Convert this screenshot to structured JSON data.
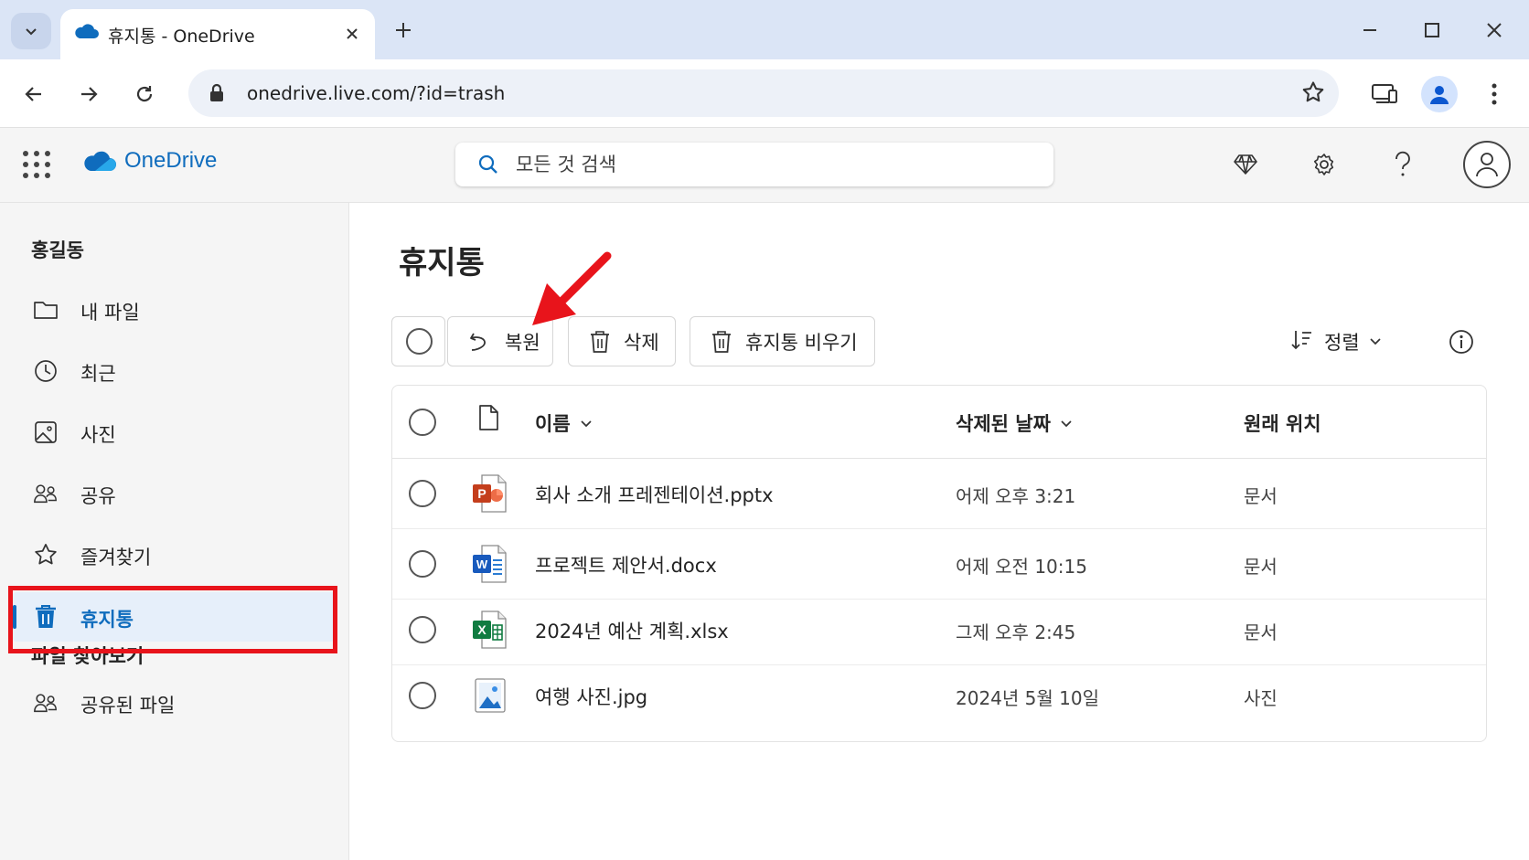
{
  "browser": {
    "tab_title": "휴지통 - OneDrive",
    "url": "onedrive.live.com/?id=trash"
  },
  "header": {
    "brand": "OneDrive",
    "search_placeholder": "모든 것 검색"
  },
  "sidebar": {
    "user_name": "홍길동",
    "items": [
      {
        "label": "내 파일",
        "icon": "folder-icon"
      },
      {
        "label": "최근",
        "icon": "clock-icon"
      },
      {
        "label": "사진",
        "icon": "image-icon"
      },
      {
        "label": "공유",
        "icon": "people-icon"
      },
      {
        "label": "즐겨찾기",
        "icon": "star-icon"
      },
      {
        "label": "휴지통",
        "icon": "trash-icon",
        "active": true
      }
    ],
    "browse_section": "파일 찾아보기",
    "browse_items": [
      {
        "label": "공유된 파일",
        "icon": "people-icon"
      }
    ]
  },
  "main": {
    "title": "휴지통",
    "commands": {
      "restore": "복원",
      "delete": "삭제",
      "empty": "휴지통 비우기",
      "sort": "정렬"
    },
    "columns": {
      "name": "이름",
      "deleted": "삭제된 날짜",
      "location": "원래 위치"
    },
    "files": [
      {
        "name": "회사 소개 프레젠테이션.pptx",
        "deleted": "어제 오후 3:21",
        "location": "문서",
        "type": "pptx"
      },
      {
        "name": "프로젝트 제안서.docx",
        "deleted": "어제 오전 10:15",
        "location": "문서",
        "type": "docx"
      },
      {
        "name": "2024년 예산 계획.xlsx",
        "deleted": "그제 오후 2:45",
        "location": "문서",
        "type": "xlsx"
      },
      {
        "name": "여행 사진.jpg",
        "deleted": "2024년 5월 10일",
        "location": "사진",
        "type": "jpg"
      }
    ]
  },
  "colors": {
    "accent": "#0f6cbd",
    "highlight_red": "#e8141b",
    "tabstrip": "#dbe5f6"
  }
}
